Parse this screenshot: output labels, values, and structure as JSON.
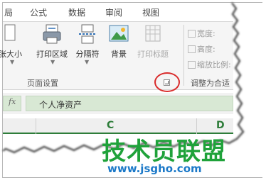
{
  "tabs": [
    "局",
    "公式",
    "数据",
    "审阅",
    "视图"
  ],
  "ribbon": {
    "commands": [
      {
        "label": "纸张大小"
      },
      {
        "label": "打印区域"
      },
      {
        "label": "分隔符"
      },
      {
        "label": "背景"
      },
      {
        "label": "打印标题",
        "disabled": true
      }
    ],
    "group_label": "页面设置",
    "scale_group": {
      "width_label": "宽度:",
      "height_label": "高度:",
      "scale_label": "缩放比例:",
      "group_label": "调整为合适"
    }
  },
  "formula_bar": {
    "fx_label": "fx",
    "content": "个人净资产"
  },
  "columns": [
    "C",
    "D"
  ],
  "watermark": {
    "text": "技术员联盟",
    "url": "www.jsgho.com"
  },
  "colors": {
    "accent_green": "#2e7d3a",
    "watermark_green": "#1fa23a",
    "watermark_blue": "#1c79c8",
    "highlight_red": "#d92b2b"
  }
}
